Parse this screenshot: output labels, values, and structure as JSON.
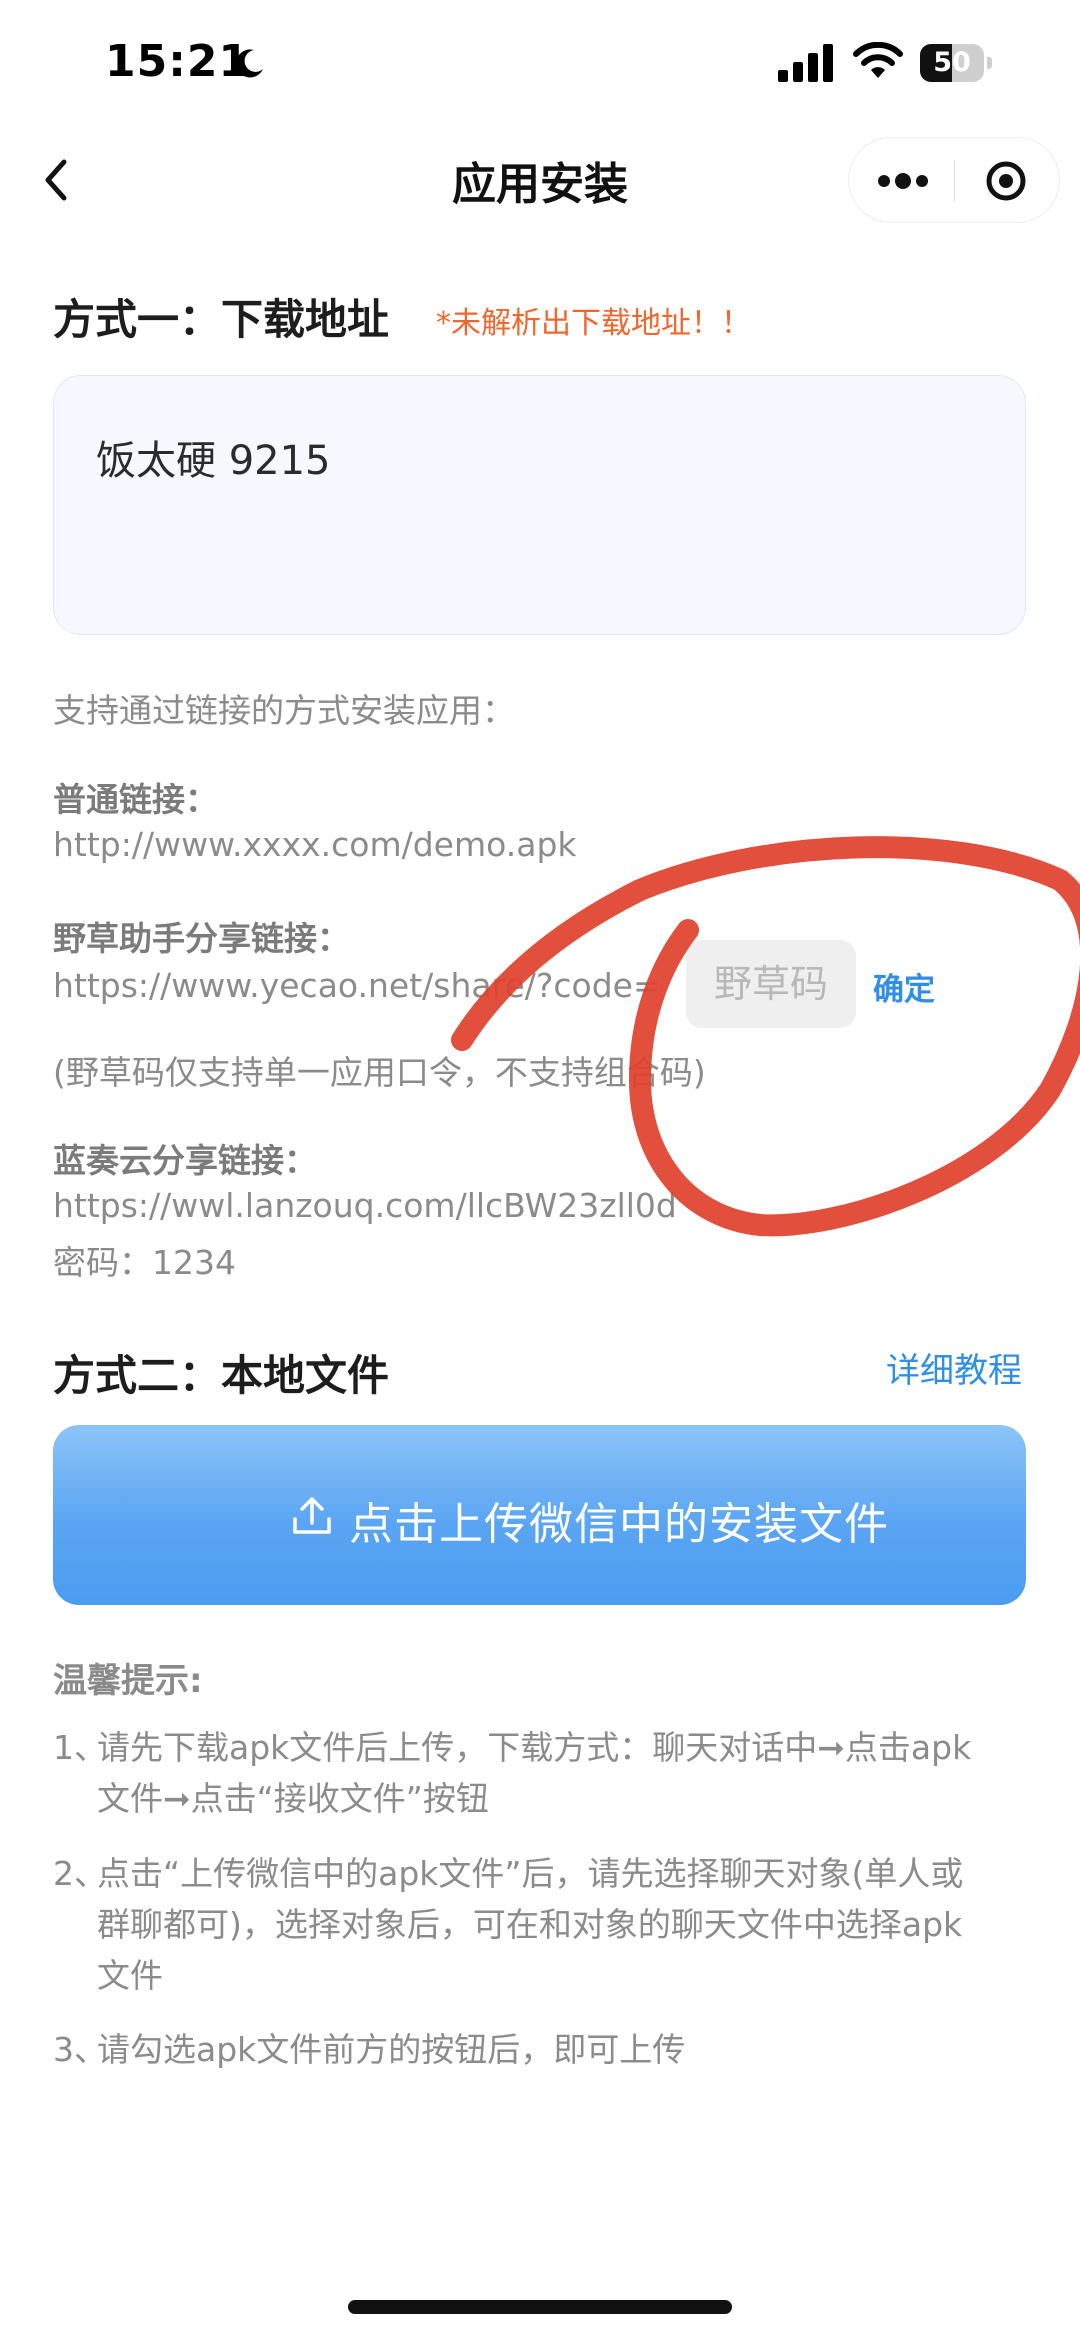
{
  "status_bar": {
    "time": "15:21",
    "battery": "50",
    "battery_level": 0.5
  },
  "nav": {
    "title": "应用安装"
  },
  "method1": {
    "title": "方式一：下载地址",
    "warning": "*未解析出下载地址！！",
    "url_value": "饭太硬 9215"
  },
  "support": {
    "intro": "支持通过链接的方式安装应用：",
    "normal_label": "普通链接：",
    "normal_url": "http://www.xxxx.com/demo.apk",
    "yecao_label": "野草助手分享链接：",
    "yecao_url": "https://www.yecao.net/share/?code=",
    "code_placeholder": "野草码",
    "confirm": "确定",
    "yecao_note": "(野草码仅支持单一应用口令，不支持组合码)",
    "lanzou_label": "蓝奏云分享链接：",
    "lanzou_url": "https://wwl.lanzouq.com/llcBW23zll0d",
    "lanzou_password": "密码：1234"
  },
  "method2": {
    "title": "方式二：本地文件",
    "detail_link": "详细教程",
    "upload_button": "点击上传微信中的安装文件"
  },
  "tips": {
    "title": "温馨提示:",
    "items": [
      {
        "num": "1、",
        "line1": "请先下载apk文件后上传，下载方式：聊天对话中➞点击apk",
        "line2": "文件➞点击“接收文件”按钮"
      },
      {
        "num": "2、",
        "line1": "点击“上传微信中的apk文件”后，请先选择聊天对象(单人或",
        "line2": "群聊都可)，选择对象后，可在和对象的聊天文件中选择apk",
        "line3": "文件"
      },
      {
        "num": "3、",
        "line1": "请勾选apk文件前方的按钮后，即可上传"
      }
    ]
  },
  "colors": {
    "accent": "#2f8fe6",
    "warning": "#f0662c",
    "annotation": "#e0402c"
  }
}
